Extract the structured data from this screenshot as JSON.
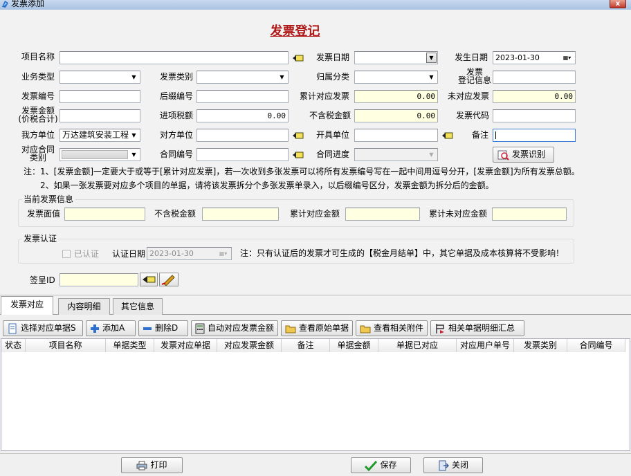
{
  "window": {
    "title": "发票添加",
    "close_label": "x"
  },
  "form_title": "发票登记",
  "fields": {
    "project_name": {
      "label": "项目名称",
      "value": ""
    },
    "invoice_date": {
      "label": "发票日期",
      "value": ""
    },
    "occur_date": {
      "label": "发生日期",
      "value": "2023-01-30"
    },
    "business_type": {
      "label": "业务类型",
      "value": ""
    },
    "invoice_category": {
      "label": "发票类别",
      "value": ""
    },
    "belong_category": {
      "label": "归属分类",
      "value": ""
    },
    "invoice_reg_info": {
      "label_line1": "发票",
      "label_line2": "登记信息",
      "value": ""
    },
    "invoice_no": {
      "label": "发票编号",
      "value": ""
    },
    "suffix_no": {
      "label": "后缀编号",
      "value": ""
    },
    "accum_matched": {
      "label": "累计对应发票",
      "value": "0.00"
    },
    "unmatched": {
      "label": "未对应发票",
      "value": "0.00"
    },
    "invoice_amount": {
      "label_line1": "发票金额",
      "label_line2": "(价税合计)",
      "value": ""
    },
    "input_tax": {
      "label": "进项税额",
      "value": "0.00"
    },
    "amount_ex_tax": {
      "label": "不含税金额",
      "value": "0.00"
    },
    "invoice_code": {
      "label": "发票代码",
      "value": ""
    },
    "our_unit": {
      "label": "我方单位",
      "value": "万达建筑安装工程"
    },
    "counterparty": {
      "label": "对方单位",
      "value": ""
    },
    "issuer": {
      "label": "开具单位",
      "value": ""
    },
    "remark": {
      "label": "备注",
      "value": ""
    },
    "contract_type": {
      "label_line1": "对应合同",
      "label_line2": "类别",
      "value": ""
    },
    "contract_no": {
      "label": "合同编号",
      "value": ""
    },
    "contract_progress": {
      "label": "合同进度",
      "value": ""
    }
  },
  "recognize_button": "发票识别",
  "notes": {
    "line1": "注：1、[发票金额]一定要大于或等于[累计对应发票]，若一次收到多张发票可以将所有发票编号写在一起中间用逗号分开，[发票金额]为所有发票总额。",
    "line2": "2、如果一张发票要对应多个项目的单据，请将该发票拆分个多张发票单录入，以后缀编号区分，发票金额为拆分后的金额。"
  },
  "current_invoice": {
    "title": "当前发票信息",
    "face_value": {
      "label": "发票面值",
      "value": ""
    },
    "ex_tax": {
      "label": "不含税金额",
      "value": ""
    },
    "accum_amount": {
      "label": "累计对应金额",
      "value": ""
    },
    "accum_unmatched": {
      "label": "累计未对应金额",
      "value": ""
    }
  },
  "certification": {
    "title": "发票认证",
    "certified_label": "已认证",
    "cert_date_label": "认证日期",
    "cert_date_value": "2023-01-30",
    "note": "注：只有认证后的发票才可生成的【税金月结单】中，其它单据及成本核算将不受影响！"
  },
  "sign_id": {
    "label": "签呈ID",
    "value": ""
  },
  "tabs": [
    "发票对应",
    "内容明细",
    "其它信息"
  ],
  "toolbar": {
    "select_docs": "选择对应单据S",
    "add": "添加A",
    "delete": "删除D",
    "auto_match": "自动对应发票金额",
    "view_original": "查看原始单据",
    "view_attach": "查看相关附件",
    "summary": "相关单据明细汇总"
  },
  "grid_columns": [
    "状态",
    "项目名称",
    "单据类型",
    "发票对应单据",
    "对应发票金额",
    "备注",
    "单据金额",
    "单据已对应",
    "对应用户单号",
    "发票类别",
    "合同编号"
  ],
  "bottom": {
    "print": "打印",
    "save": "保存",
    "close": "关闭"
  },
  "colors": {
    "title_red": "#b01818",
    "yellow_field": "#ffffe1"
  }
}
